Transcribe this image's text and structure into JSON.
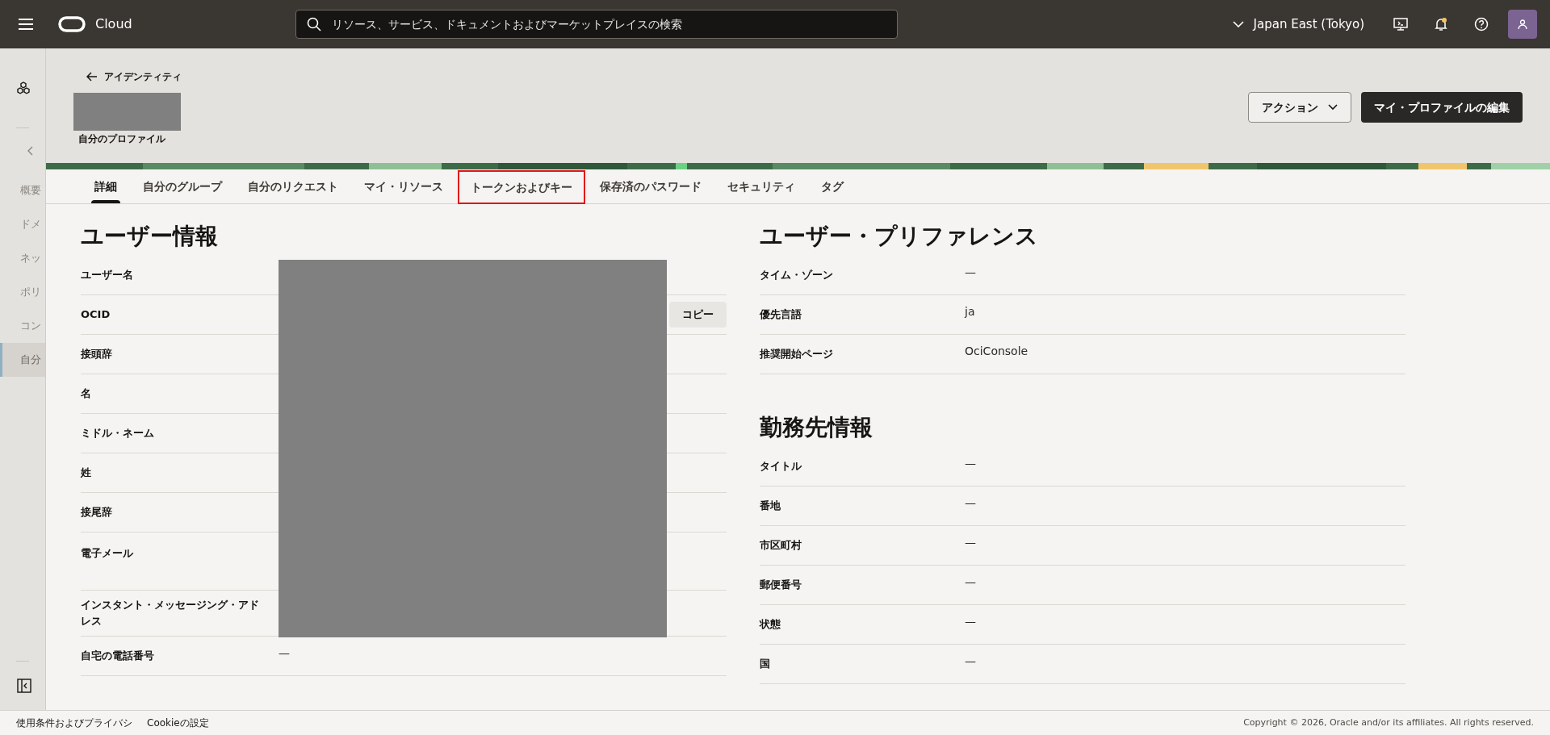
{
  "top_bar": {
    "brand": "Cloud",
    "search": {
      "placeholder": "リソース、サービス、ドキュメントおよびマーケットプレイスの検索"
    },
    "region": "Japan East (Tokyo)"
  },
  "sidebar": {
    "items": [
      {
        "label": "概要",
        "selected": false
      },
      {
        "label": "ドメ",
        "selected": false
      },
      {
        "label": "ネッ",
        "selected": false
      },
      {
        "label": "ポリ",
        "selected": false
      },
      {
        "label": "コン",
        "selected": false
      },
      {
        "label": "自分",
        "selected": true
      }
    ]
  },
  "header": {
    "back_link": "アイデンティティ",
    "subtitle": "自分のプロファイル",
    "actions_button": "アクション",
    "edit_button": "マイ・プロファイルの編集"
  },
  "tabs": [
    {
      "label": "詳細",
      "selected": true,
      "highlighted": false
    },
    {
      "label": "自分のグループ",
      "selected": false,
      "highlighted": false
    },
    {
      "label": "自分のリクエスト",
      "selected": false,
      "highlighted": false
    },
    {
      "label": "マイ・リソース",
      "selected": false,
      "highlighted": false
    },
    {
      "label": "トークンおよびキー",
      "selected": false,
      "highlighted": true
    },
    {
      "label": "保存済のパスワード",
      "selected": false,
      "highlighted": false
    },
    {
      "label": "セキュリティ",
      "selected": false,
      "highlighted": false
    },
    {
      "label": "タグ",
      "selected": false,
      "highlighted": false
    }
  ],
  "user_info": {
    "title": "ユーザー情報",
    "rows": [
      {
        "label": "ユーザー名",
        "kind": "plain"
      },
      {
        "label": "OCID",
        "kind": "copy",
        "button": "コピー"
      },
      {
        "label": "接頭辞",
        "kind": "plain"
      },
      {
        "label": "名",
        "kind": "plain"
      },
      {
        "label": "ミドル・ネーム",
        "kind": "plain"
      },
      {
        "label": "姓",
        "kind": "plain"
      },
      {
        "label": "接尾辞",
        "kind": "plain"
      },
      {
        "label": "電子メール",
        "kind": "tall"
      },
      {
        "label": "インスタント・メッセージング・アドレス",
        "kind": "plain"
      },
      {
        "label": "自宅の電話番号",
        "kind": "plain",
        "value": "—"
      }
    ]
  },
  "user_preferences": {
    "title": "ユーザー・プリファレンス",
    "rows": [
      {
        "label": "タイム・ゾーン",
        "value": "—"
      },
      {
        "label": "優先言語",
        "value": "ja"
      },
      {
        "label": "推奨開始ページ",
        "value": "OciConsole"
      }
    ]
  },
  "work_info": {
    "title": "勤務先情報",
    "rows": [
      {
        "label": "タイトル",
        "value": "—"
      },
      {
        "label": "番地",
        "value": "—"
      },
      {
        "label": "市区町村",
        "value": "—"
      },
      {
        "label": "郵便番号",
        "value": "—"
      },
      {
        "label": "状態",
        "value": "—"
      },
      {
        "label": "国",
        "value": "—"
      }
    ]
  },
  "footer": {
    "links": [
      "使用条件およびプライバシ",
      "Cookieの設定"
    ],
    "copyright": "Copyright © 2026, Oracle and/or its affiliates. All rights reserved."
  }
}
